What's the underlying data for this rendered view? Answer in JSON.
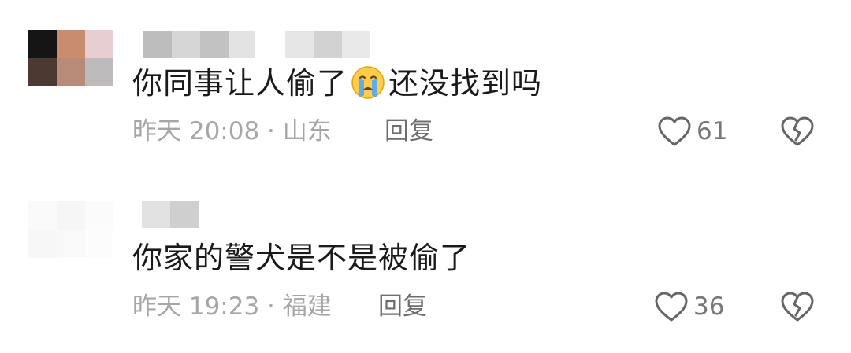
{
  "comments": [
    {
      "text_before_emoji": "你同事让人偷了",
      "emoji": "crying-face-emoji",
      "text_after_emoji": "还没找到吗",
      "meta": "昨天 20:08 · 山东",
      "reply_label": "回复",
      "likes": "61"
    },
    {
      "text": "你家的警犬是不是被偷了",
      "meta": "昨天 19:23 · 福建",
      "reply_label": "回复",
      "likes": "36"
    }
  ],
  "colors": {
    "text": "#1a1a1a",
    "meta": "#a6a6a6",
    "reply": "#6e6e6e",
    "icon": "#666666"
  }
}
